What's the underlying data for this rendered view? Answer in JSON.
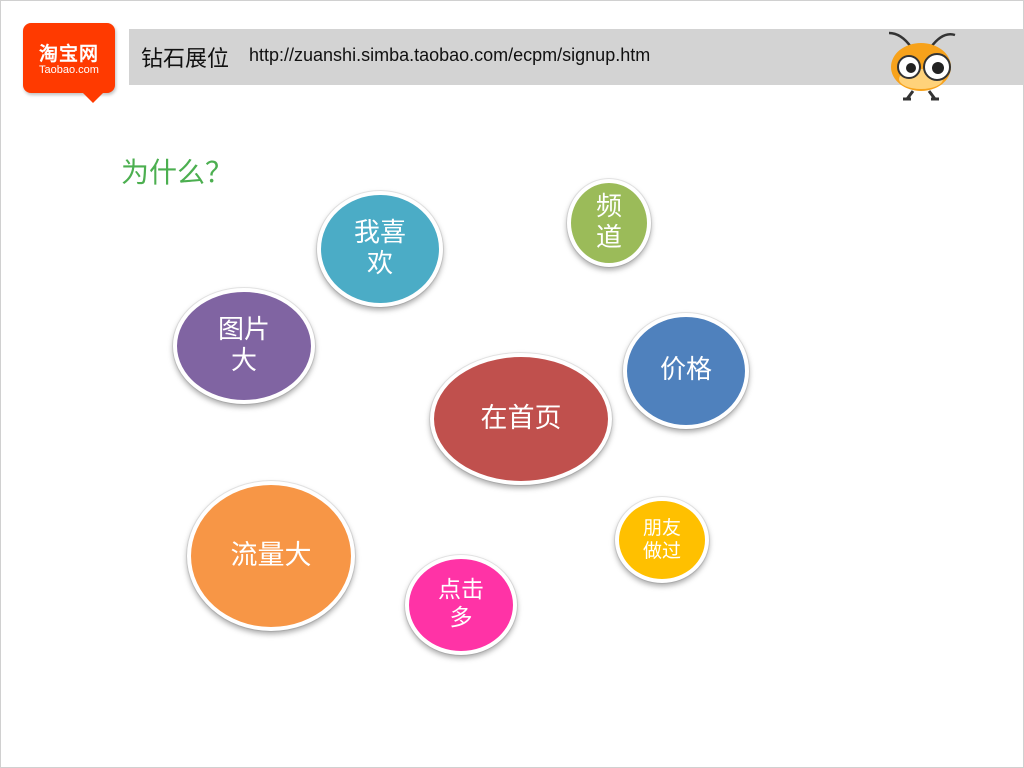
{
  "header": {
    "logo_cn": "淘宝网",
    "logo_en": "Taobao.com",
    "title": "钻石展位",
    "url": "http://zuanshi.simba.taobao.com/ecpm/signup.htm"
  },
  "question": "为什么？",
  "bubbles": {
    "pindao": {
      "label": "频\n道",
      "color": "#9bbb59"
    },
    "woxihuan": {
      "label": "我喜\n欢",
      "color": "#4bacc6"
    },
    "tupian": {
      "label": "图片\n大",
      "color": "#8064a2"
    },
    "jiage": {
      "label": "价格",
      "color": "#4f81bd"
    },
    "shouye": {
      "label": "在首页",
      "color": "#c0504d"
    },
    "pengyou": {
      "label": "朋友\n做过",
      "color": "#ffc000"
    },
    "liuliang": {
      "label": "流量大",
      "color": "#f79646"
    },
    "dianji": {
      "label": "点击\n多",
      "color": "#ff33a6"
    }
  }
}
